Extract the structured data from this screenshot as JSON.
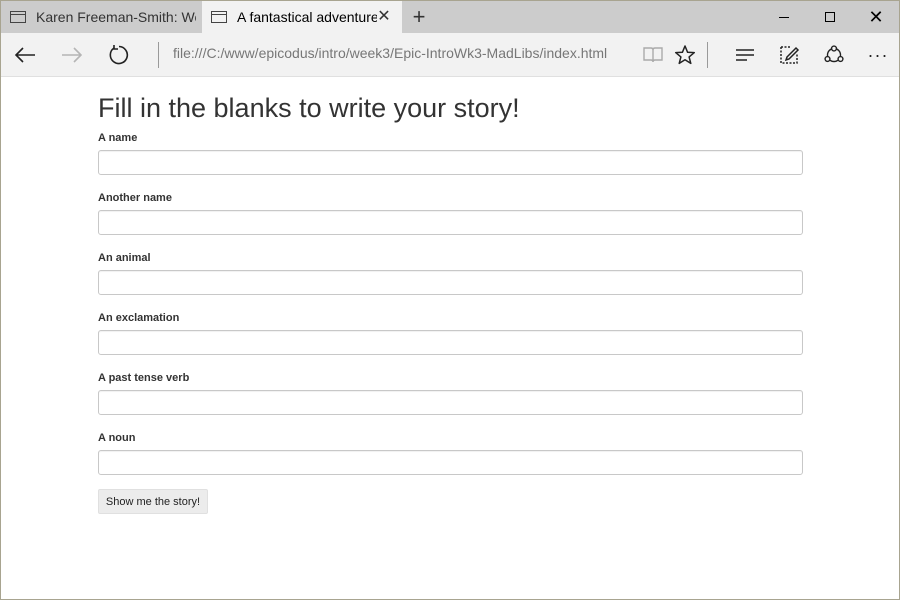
{
  "browser": {
    "tabs": [
      {
        "title": "Karen Freeman-Smith: Web",
        "active": false
      },
      {
        "title": "A fantastical adventure",
        "active": true
      }
    ],
    "new_tab_symbol": "+",
    "address": "file:///C:/www/epicodus/intro/week3/Epic-IntroWk3-MadLibs/index.html",
    "icons": {
      "back": "back-arrow-icon",
      "forward": "forward-arrow-icon",
      "refresh": "refresh-icon",
      "reading_view": "book-icon",
      "favorite": "star-icon",
      "hub": "hub-icon",
      "web_note": "pen-icon",
      "share": "share-icon",
      "more": "more-icon",
      "tab_page": "page-icon",
      "tab_close": "close-icon"
    },
    "window_controls": {
      "minimize": "minimize-icon",
      "maximize": "maximize-icon",
      "close": "close-icon"
    },
    "colors": {
      "tab_strip": "#cccccc",
      "active_tab": "#f2f2f2",
      "toolbar": "#f2f2f2"
    }
  },
  "page": {
    "title": "Fill in the blanks to write your story!",
    "fields": [
      {
        "label": "A name",
        "value": ""
      },
      {
        "label": "Another name",
        "value": ""
      },
      {
        "label": "An animal",
        "value": ""
      },
      {
        "label": "An exclamation",
        "value": ""
      },
      {
        "label": "A past tense verb",
        "value": ""
      },
      {
        "label": "A noun",
        "value": ""
      }
    ],
    "submit_label": "Show me the story!"
  }
}
